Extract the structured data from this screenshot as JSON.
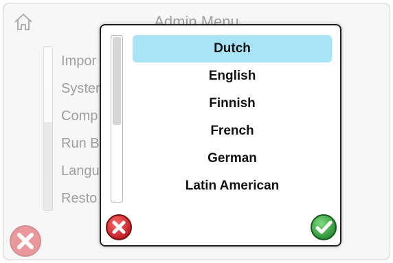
{
  "background_screen": {
    "title": "Admin Menu",
    "home_icon": "home-icon",
    "menu_items": [
      {
        "label": "Impor"
      },
      {
        "label": "Syster"
      },
      {
        "label": "Comp"
      },
      {
        "label": "Run B"
      },
      {
        "label": "Langu"
      },
      {
        "label": "Resto"
      }
    ],
    "close_icon": "close-x-icon"
  },
  "language_dialog": {
    "languages": [
      {
        "label": "Dutch",
        "selected": true
      },
      {
        "label": "English",
        "selected": false
      },
      {
        "label": "Finnish",
        "selected": false
      },
      {
        "label": "French",
        "selected": false
      },
      {
        "label": "German",
        "selected": false
      },
      {
        "label": "Latin American",
        "selected": false
      }
    ],
    "cancel_icon": "cancel-x-icon",
    "ok_icon": "confirm-check-icon"
  },
  "colors": {
    "selected_highlight": "#a8e4f8",
    "cancel_red": "#d9242b",
    "confirm_green": "#3aa84a"
  }
}
